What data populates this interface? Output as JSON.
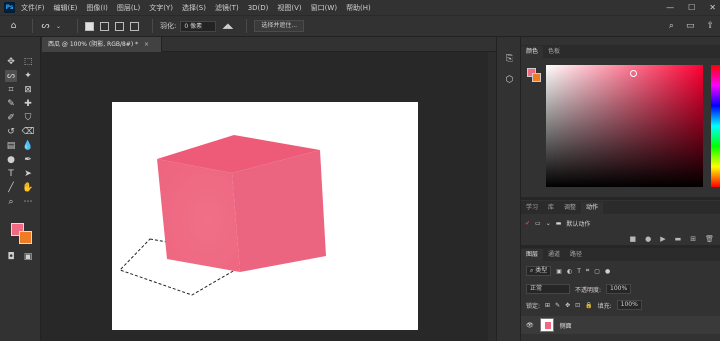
{
  "menubar": {
    "logo": "Ps",
    "items": [
      "文件(F)",
      "编辑(E)",
      "图像(I)",
      "图层(L)",
      "文字(Y)",
      "选择(S)",
      "滤镜(T)",
      "3D(D)",
      "视图(V)",
      "窗口(W)",
      "帮助(H)"
    ],
    "win_minimize": "—",
    "win_maximize": "☐",
    "win_close": "✕"
  },
  "options": {
    "home_icon": "home-icon",
    "feather_label": "羽化:",
    "feather_value": "0 像素",
    "select_mask_button": "选择并遮住..."
  },
  "document": {
    "tab_title": "西瓜 @ 100% (阴影, RGB/8#) *",
    "tab_close": "×"
  },
  "colors": {
    "foreground": "#f06a84",
    "background": "#f07b25",
    "cube_front": "#f06a84",
    "cube_top": "#ee5a77",
    "cube_side": "#ea5f7c"
  },
  "color_panel": {
    "tabs": [
      "颜色",
      "色板"
    ],
    "active_tab": "颜色"
  },
  "actions_panel": {
    "tabs": [
      "学习",
      "库",
      "调整",
      "动作"
    ],
    "active_tab": "动作",
    "set_name": "默认动作"
  },
  "layers_panel": {
    "tabs": [
      "图层",
      "通道",
      "路径"
    ],
    "active_tab": "图层",
    "filter_kind": "类型",
    "blend_mode": "正常",
    "opacity_label": "不透明度:",
    "opacity_value": "100%",
    "lock_label": "锁定:",
    "fill_label": "填充:",
    "fill_value": "100%",
    "layers": [
      {
        "name": "侧面",
        "visible": true
      }
    ]
  }
}
